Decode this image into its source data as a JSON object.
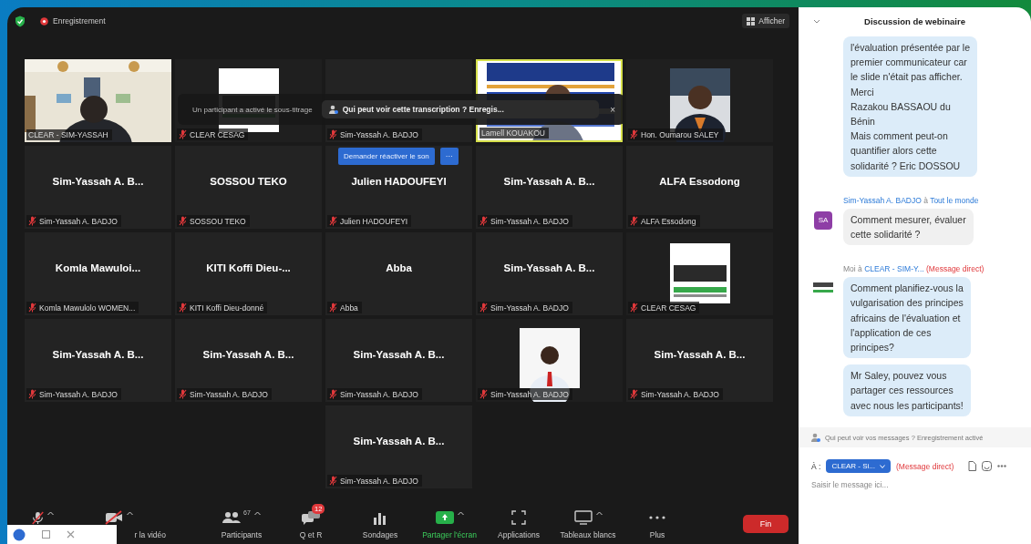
{
  "top_bar": {
    "recording": "Enregistrement",
    "view_button": "Afficher"
  },
  "tiles": [
    {
      "kind": "picture",
      "label": "CLEAR - SIM-YASSAH",
      "muted": false,
      "speaking": false
    },
    {
      "kind": "picture",
      "label": "CLEAR CESAG",
      "muted": true,
      "speaking": false
    },
    {
      "kind": "blank",
      "label": "Sim-Yassah A. BADJO",
      "muted": true,
      "speaking": false
    },
    {
      "kind": "picture",
      "label": "Lamell KOUAKOU",
      "muted": false,
      "speaking": true
    },
    {
      "kind": "picture",
      "label": "Hon. Oumarou SALEY",
      "muted": true,
      "speaking": false
    },
    {
      "kind": "name",
      "display_name": "Sim-Yassah A. B...",
      "label": "Sim-Yassah A. BADJO",
      "muted": true,
      "speaking": false
    },
    {
      "kind": "name",
      "display_name": "SOSSOU TEKO",
      "label": "SOSSOU TEKO",
      "muted": true,
      "speaking": false
    },
    {
      "kind": "name",
      "display_name": "Julien HADOUFEYI",
      "label": "Julien HADOUFEYI",
      "muted": true,
      "speaking": false
    },
    {
      "kind": "name",
      "display_name": "Sim-Yassah A. B...",
      "label": "Sim-Yassah A. BADJO",
      "muted": true,
      "speaking": false
    },
    {
      "kind": "name",
      "display_name": "ALFA Essodong",
      "label": "ALFA Essodong",
      "muted": true,
      "speaking": false
    },
    {
      "kind": "name",
      "display_name": "Komla Mawuloi...",
      "label": "Komla Mawulolo WOMEN...",
      "muted": true,
      "speaking": false
    },
    {
      "kind": "name",
      "display_name": "KITI Koffi Dieu-...",
      "label": "KITI Koffi Dieu-donné",
      "muted": true,
      "speaking": false
    },
    {
      "kind": "name",
      "display_name": "Abba",
      "label": "Abba",
      "muted": true,
      "speaking": false
    },
    {
      "kind": "name",
      "display_name": "Sim-Yassah A. B...",
      "label": "Sim-Yassah A. BADJO",
      "muted": true,
      "speaking": false
    },
    {
      "kind": "picture",
      "label": "CLEAR CESAG",
      "muted": true,
      "speaking": false
    },
    {
      "kind": "name",
      "display_name": "Sim-Yassah A. B...",
      "label": "Sim-Yassah A. BADJO",
      "muted": true,
      "speaking": false
    },
    {
      "kind": "name",
      "display_name": "Sim-Yassah A. B...",
      "label": "Sim-Yassah A. BADJO",
      "muted": true,
      "speaking": false
    },
    {
      "kind": "name",
      "display_name": "Sim-Yassah A. B...",
      "label": "Sim-Yassah A. BADJO",
      "muted": true,
      "speaking": false
    },
    {
      "kind": "picture",
      "label": "Sim-Yassah A. BADJO",
      "muted": true,
      "speaking": false
    },
    {
      "kind": "name",
      "display_name": "Sim-Yassah A. B...",
      "label": "Sim-Yassah A. BADJO",
      "muted": true,
      "speaking": false
    },
    {
      "kind": "name",
      "display_name": "Sim-Yassah A. B...",
      "label": "Sim-Yassah A. BADJO",
      "muted": true,
      "speaking": false
    }
  ],
  "caption_banner": {
    "message": "Un participant a activé le sous-titrage",
    "link": "Qui peut voir cette transcription ? Enregis...",
    "close": "×"
  },
  "unmute_request": {
    "button": "Demander réactiver le son",
    "more": "···"
  },
  "toolbar": [
    {
      "kind": "mic"
    },
    {
      "kind": "video",
      "label": "r la vidéo"
    },
    {
      "kind": "participants",
      "label": "Participants",
      "count": "67"
    },
    {
      "kind": "qa",
      "label": "Q et R",
      "badge": "12"
    },
    {
      "kind": "polls",
      "label": "Sondages"
    },
    {
      "kind": "share",
      "label": "Partager l'écran"
    },
    {
      "kind": "apps",
      "label": "Applications"
    },
    {
      "kind": "whiteboard",
      "label": "Tableaux blancs"
    },
    {
      "kind": "more",
      "label": "Plus"
    }
  ],
  "end_button": "Fin",
  "chat": {
    "title": "Discussion de webinaire",
    "messages": [
      {
        "kind": "continued",
        "bubbles": [
          "l'évaluation présentée par le\npremier communicateur car\nle slide n'était pas afficher.\nMerci\nRazakou BASSAOU du\nBénin\nMais comment peut-on\nquantifier alors cette\nsolidarité ? Eric DOSSOU"
        ]
      },
      {
        "kind": "received",
        "from": "Sim-Yassah A. BADJO",
        "connector": "à",
        "to": "Tout le monde",
        "avatar": "SA",
        "bubbles": [
          "Comment mesurer, évaluer\ncette solidarité ?"
        ]
      },
      {
        "kind": "sent",
        "from": "Moi",
        "connector": "à",
        "to": "CLEAR - SIM-Y...",
        "note": "(Message direct)",
        "bubbles": [
          "Comment planifiez-vous la\nvulgarisation des principes\nafricains de l'évaluation et\nl'application de ces\nprincipes?",
          "Mr Saley, pouvez vous\npartager ces ressources\navec nous les participants!"
        ]
      }
    ],
    "notice": "Qui peut voir vos messages ? Enregistrement activé",
    "recipient_label": "À :",
    "recipient": "CLEAR - Si...",
    "direct_note": "(Message direct)",
    "input_placeholder": "Saisir le message ici..."
  }
}
